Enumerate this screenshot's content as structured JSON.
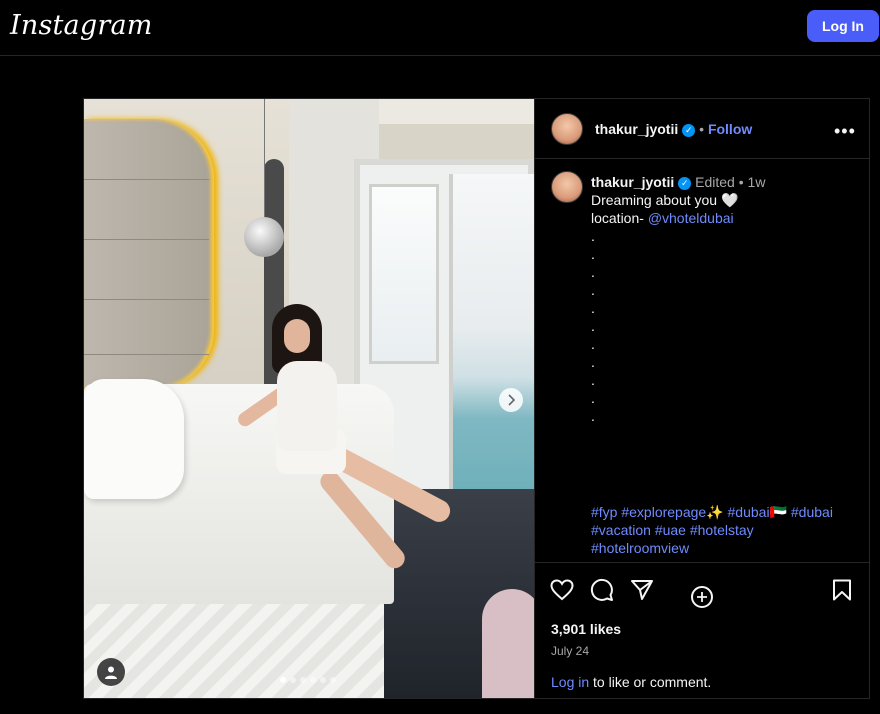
{
  "header": {
    "logo": "Instagram",
    "login_button": "Log In"
  },
  "post": {
    "author": {
      "username": "thakur_jyotii",
      "verified_icon": "verified-badge-icon",
      "separator": "•",
      "follow": "Follow"
    },
    "caption": {
      "username": "thakur_jyotii",
      "edited": "Edited",
      "separator": "•",
      "age": "1w",
      "line1": "Dreaming about you 🤍",
      "location_prefix": "location- ",
      "location_handle": "@vhoteldubai",
      "dots": [
        ".",
        ".",
        ".",
        ".",
        ".",
        ".",
        ".",
        ".",
        ".",
        ".",
        "."
      ],
      "hashtags_line1": "#fyp #explorepage✨ #dubai🇦🇪 #dubai",
      "hashtags_line2": "#vacation #uae #hotelstay",
      "hashtags_line3": "#hotelroomview"
    },
    "media": {
      "slide_count": 6,
      "active_slide": 1
    },
    "stats": {
      "likes": "3,901 likes",
      "date": "July 24"
    },
    "footer": {
      "login_link": "Log in",
      "login_suffix": " to like or comment."
    }
  },
  "colors": {
    "accent_blue": "#4a5df9",
    "link_blue": "#6f8bff",
    "verified_blue": "#0095f6",
    "background": "#000000",
    "border": "#262626"
  }
}
